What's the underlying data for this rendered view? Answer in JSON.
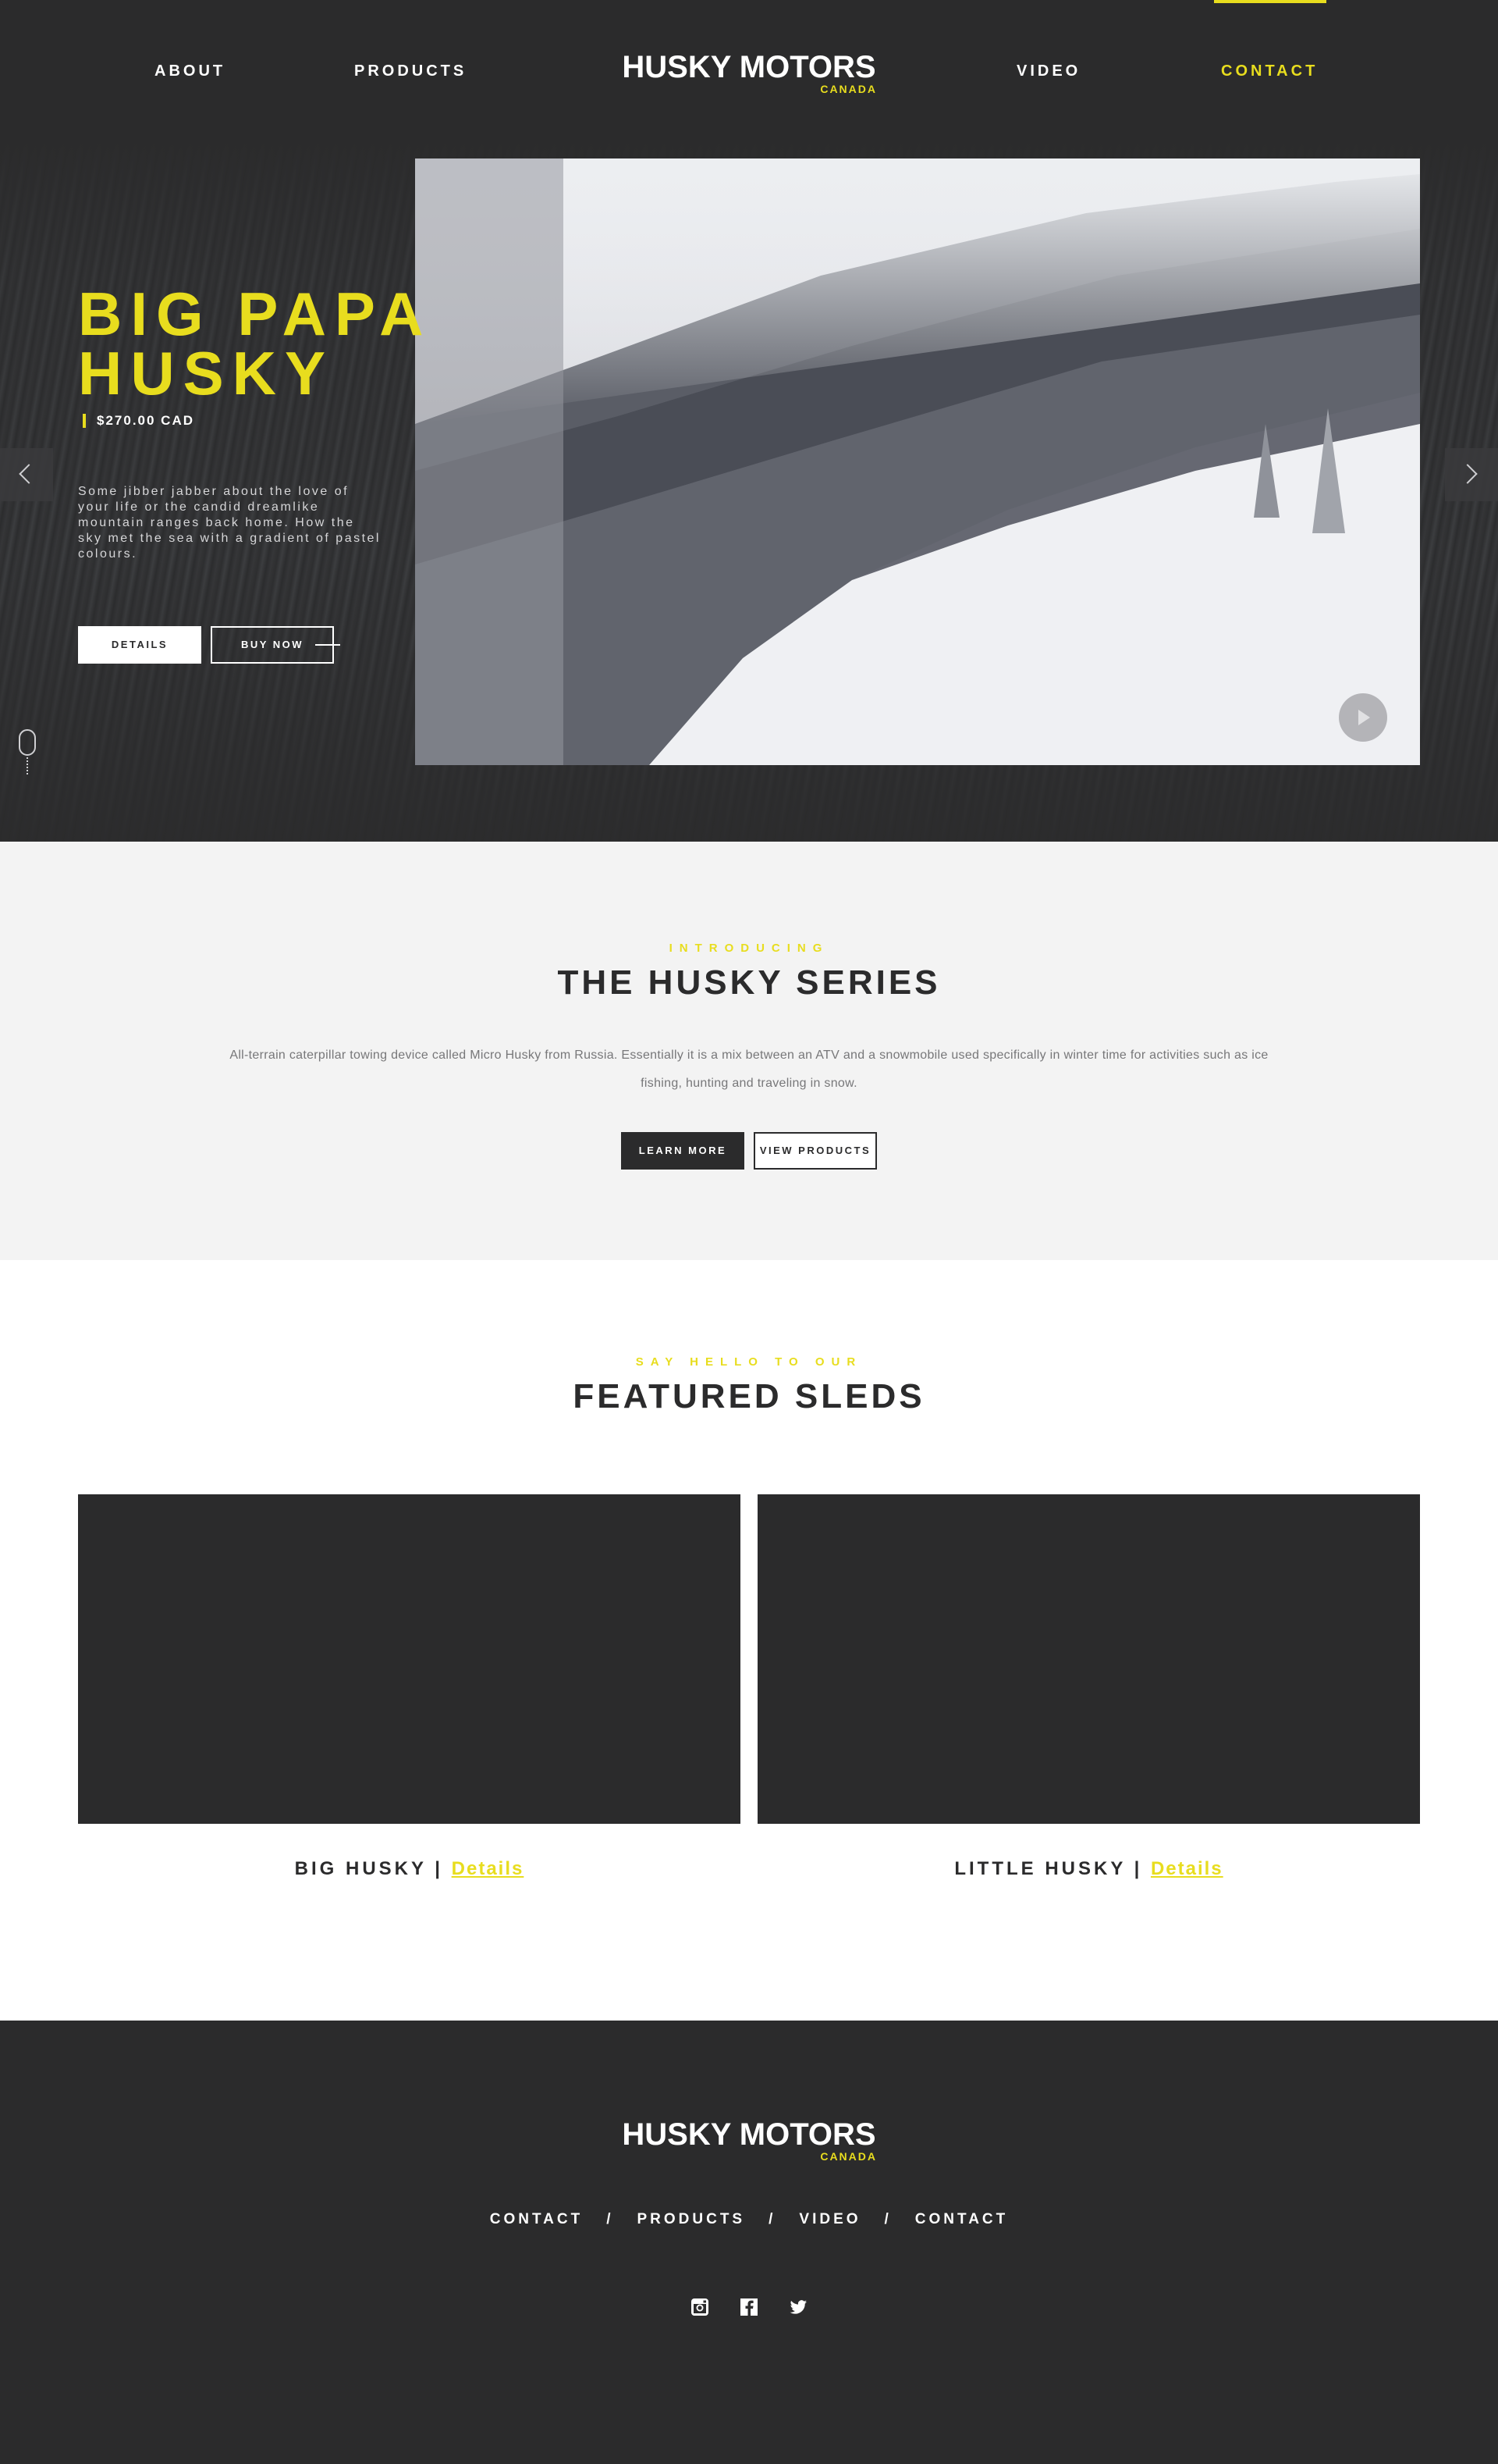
{
  "nav": {
    "items": [
      {
        "label": "ABOUT"
      },
      {
        "label": "PRODUCTS"
      },
      {
        "label": "VIDEO"
      },
      {
        "label": "CONTACT",
        "active": true
      }
    ],
    "brand": {
      "name": "HUSKY MOTORS",
      "sub": "CANADA"
    }
  },
  "hero": {
    "title_line1": "BIG PAPA",
    "title_line2": "HUSKY",
    "price": "$270.00 CAD",
    "description": "Some jibber jabber about the love of your life or the candid dreamlike mountain ranges back home. How the sky met the sea with a gradient of pastel colours.",
    "details_label": "DETAILS",
    "buy_label": "BUY NOW"
  },
  "intro": {
    "eyebrow": "INTRODUCING",
    "title": "THE HUSKY SERIES",
    "text": "All-terrain caterpillar towing device called Micro Husky from Russia. Essentially it is a mix between an ATV and a snowmobile used specifically in winter time for activities such as ice fishing, hunting and traveling in snow.",
    "learn_label": "LEARN MORE",
    "view_label": "VIEW PRODUCTS"
  },
  "featured": {
    "eyebrow": "SAY HELLO TO OUR",
    "title": "FEATURED SLEDS",
    "cards": [
      {
        "name": "BIG HUSKY",
        "sep": "|",
        "link": "Details"
      },
      {
        "name": "LITTLE HUSKY",
        "sep": "|",
        "link": "Details"
      }
    ]
  },
  "footer": {
    "brand": {
      "name": "HUSKY MOTORS",
      "sub": "CANADA"
    },
    "nav": [
      {
        "label": "CONTACT"
      },
      {
        "label": "PRODUCTS"
      },
      {
        "label": "VIDEO"
      },
      {
        "label": "CONTACT"
      }
    ],
    "separator": "/",
    "social": [
      "instagram-icon",
      "facebook-icon",
      "twitter-icon"
    ]
  },
  "colors": {
    "accent": "#e8dd1e",
    "dark": "#2b2b2c",
    "light": "#f3f3f3"
  }
}
